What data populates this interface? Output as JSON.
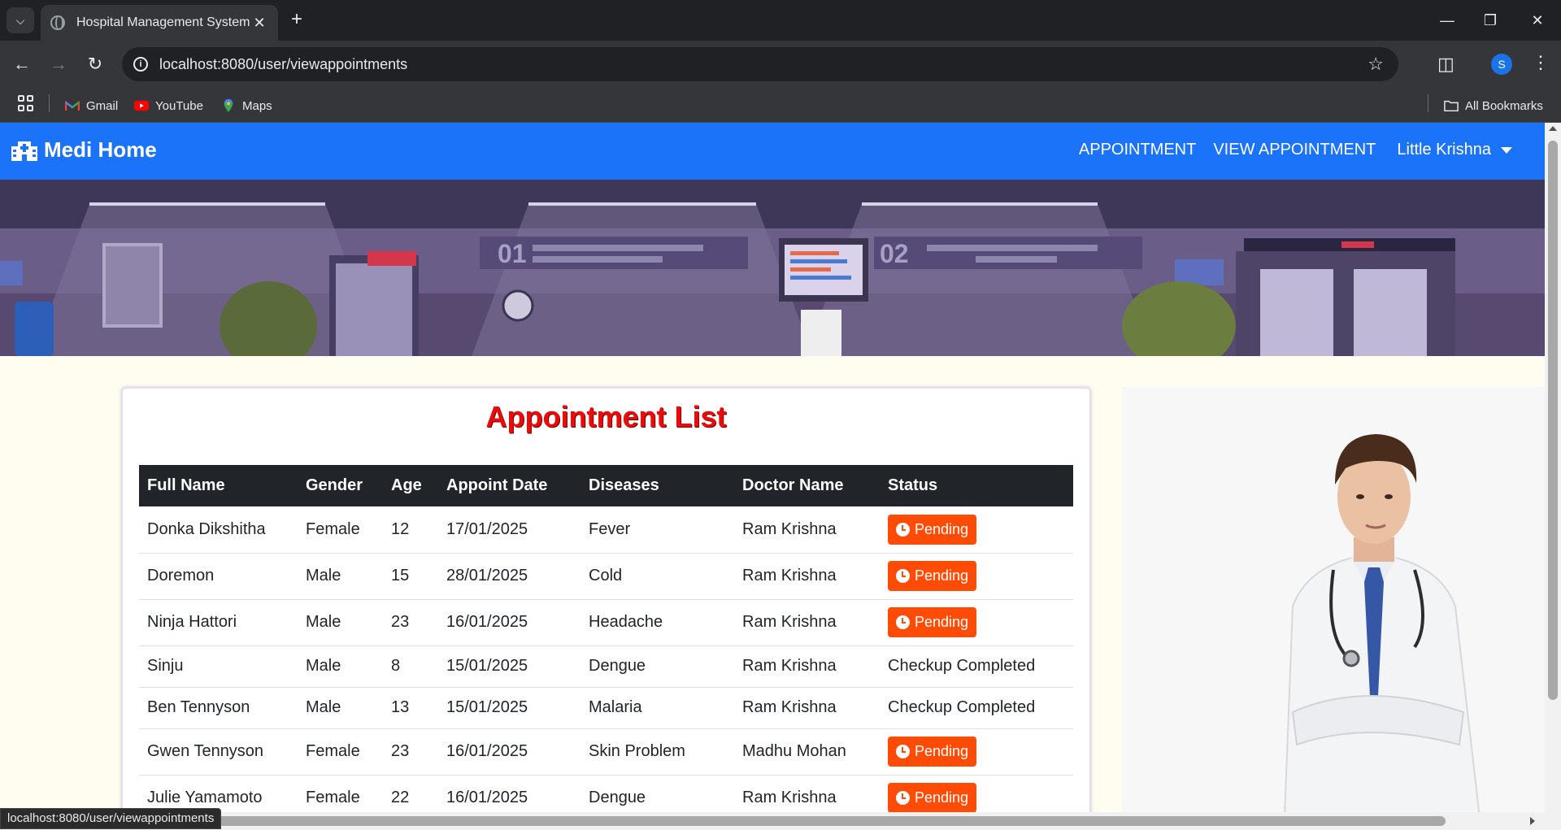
{
  "browser": {
    "tab_title": "Hospital Management System",
    "url": "localhost:8080/user/viewappointments",
    "profile_initial": "S",
    "bookmarks": [
      {
        "label": "Gmail",
        "icon": "gmail-icon"
      },
      {
        "label": "YouTube",
        "icon": "youtube-icon"
      },
      {
        "label": "Maps",
        "icon": "maps-icon"
      }
    ],
    "all_bookmarks_label": "All Bookmarks",
    "status_url": "localhost:8080/user/viewappointments"
  },
  "navbar": {
    "brand": "Medi Home",
    "links": [
      "APPOINTMENT",
      "VIEW APPOINTMENT"
    ],
    "user_name": "Little Krishna",
    "color": "#1a73f8"
  },
  "appointments": {
    "title": "Appointment List",
    "columns": [
      "Full Name",
      "Gender",
      "Age",
      "Appoint Date",
      "Diseases",
      "Doctor Name",
      "Status"
    ],
    "rows": [
      {
        "name": "Donka Dikshitha",
        "gender": "Female",
        "age": "12",
        "date": "17/01/2025",
        "disease": "Fever",
        "doctor": "Ram Krishna",
        "status": "Pending"
      },
      {
        "name": "Doremon",
        "gender": "Male",
        "age": "15",
        "date": "28/01/2025",
        "disease": "Cold",
        "doctor": "Ram Krishna",
        "status": "Pending"
      },
      {
        "name": "Ninja Hattori",
        "gender": "Male",
        "age": "23",
        "date": "16/01/2025",
        "disease": "Headache",
        "doctor": "Ram Krishna",
        "status": "Pending"
      },
      {
        "name": "Sinju",
        "gender": "Male",
        "age": "8",
        "date": "15/01/2025",
        "disease": "Dengue",
        "doctor": "Ram Krishna",
        "status": "Checkup Completed"
      },
      {
        "name": "Ben Tennyson",
        "gender": "Male",
        "age": "13",
        "date": "15/01/2025",
        "disease": "Malaria",
        "doctor": "Ram Krishna",
        "status": "Checkup Completed"
      },
      {
        "name": "Gwen Tennyson",
        "gender": "Female",
        "age": "23",
        "date": "16/01/2025",
        "disease": "Skin Problem",
        "doctor": "Madhu Mohan",
        "status": "Pending"
      },
      {
        "name": "Julie Yamamoto",
        "gender": "Female",
        "age": "22",
        "date": "16/01/2025",
        "disease": "Dengue",
        "doctor": "Ram Krishna",
        "status": "Pending"
      }
    ],
    "pending_color": "#fe4c07",
    "title_color": "#ea0b0b"
  }
}
